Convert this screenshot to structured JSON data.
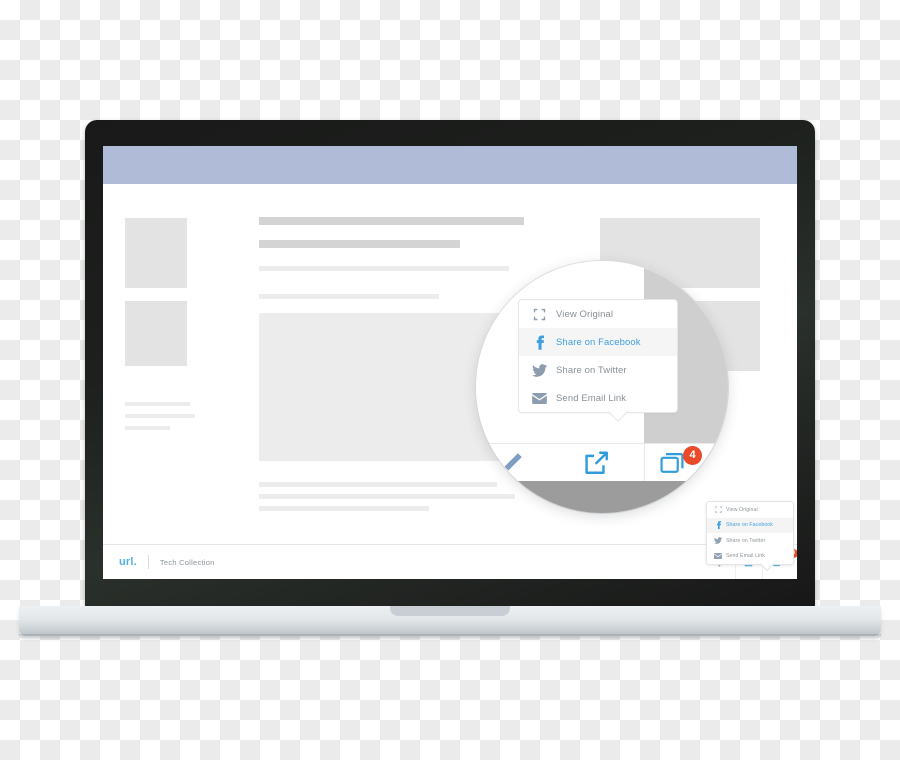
{
  "device": {
    "type": "laptop-mockup",
    "frame_color": "#1d201d",
    "base_color": "#e2e6e9"
  },
  "browser_page": {
    "header_bar_color": "#b0bcd7",
    "background_color": "#ffffff",
    "placeholder_block_color": "#e3e3e3"
  },
  "footer": {
    "brand_label": "url.",
    "brand_color": "#55b3e4",
    "collection_label": "Tech Collection",
    "actions": [
      {
        "name": "edit",
        "icon": "pencil-icon"
      },
      {
        "name": "share",
        "icon": "share-icon"
      },
      {
        "name": "collection",
        "icon": "collection-icon",
        "badge": "4"
      }
    ]
  },
  "share_menu": {
    "items": [
      {
        "label": "View Original",
        "icon": "expand-icon",
        "active": false
      },
      {
        "label": "Share on Facebook",
        "icon": "facebook-icon",
        "active": true
      },
      {
        "label": "Share on Twitter",
        "icon": "twitter-icon",
        "active": false
      },
      {
        "label": "Send Email Link",
        "icon": "envelope-icon",
        "active": false
      }
    ],
    "active_item_color": "#3fa0dd",
    "inactive_item_color": "#8a9196",
    "active_row_background": "#f5f5f5"
  },
  "magnifier": {
    "label": "magnified-detail-lens",
    "actions": [
      {
        "name": "edit",
        "icon": "pencil-icon"
      },
      {
        "name": "share",
        "icon": "share-icon"
      },
      {
        "name": "collection",
        "icon": "collection-icon",
        "badge": "4"
      }
    ],
    "badge_color": "#ea4a2a",
    "icon_color": "#3fa0dd"
  }
}
